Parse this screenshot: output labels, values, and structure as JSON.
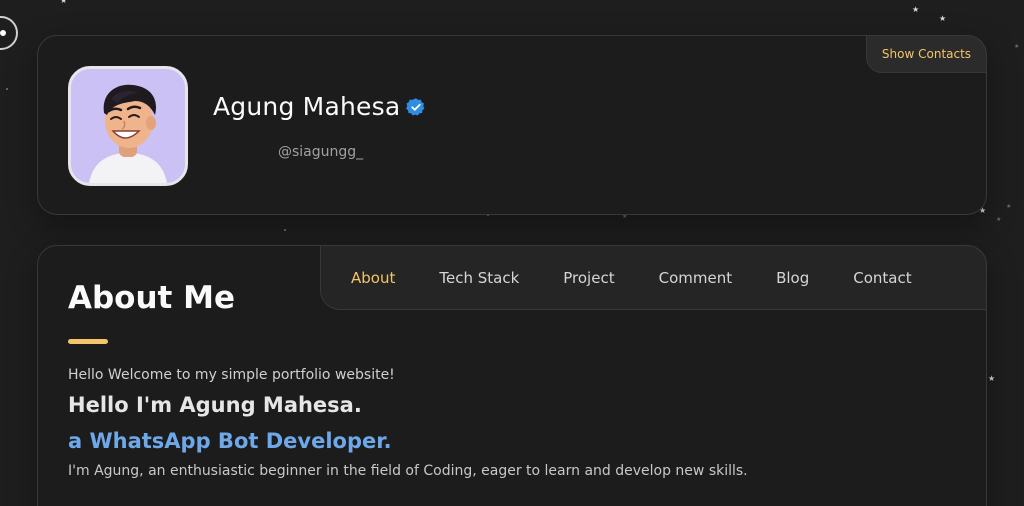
{
  "profile": {
    "name": "Agung Mahesa",
    "username": "@siagungg_",
    "show_contacts_label": "Show Contacts",
    "avatar_icon": "avatar-3d-character",
    "verified_icon": "verified-badge-icon"
  },
  "nav": {
    "items": [
      {
        "label": "About",
        "active": true
      },
      {
        "label": "Tech Stack",
        "active": false
      },
      {
        "label": "Project",
        "active": false
      },
      {
        "label": "Comment",
        "active": false
      },
      {
        "label": "Blog",
        "active": false
      },
      {
        "label": "Contact",
        "active": false
      }
    ]
  },
  "about": {
    "title": "About Me",
    "welcome": "Hello Welcome to my simple portfolio website!",
    "greeting": "Hello I'm Agung Mahesa.",
    "role": "a WhatsApp Bot Developer.",
    "bio": "I'm Agung, an enthusiastic beginner in the field of Coding, eager to learn and develop new skills."
  },
  "colors": {
    "background": "#1e1e1f",
    "card": "#1c1c1d",
    "accent": "#f4c46a",
    "role_blue": "#6fa8e8",
    "verified_blue": "#2f8de4"
  }
}
